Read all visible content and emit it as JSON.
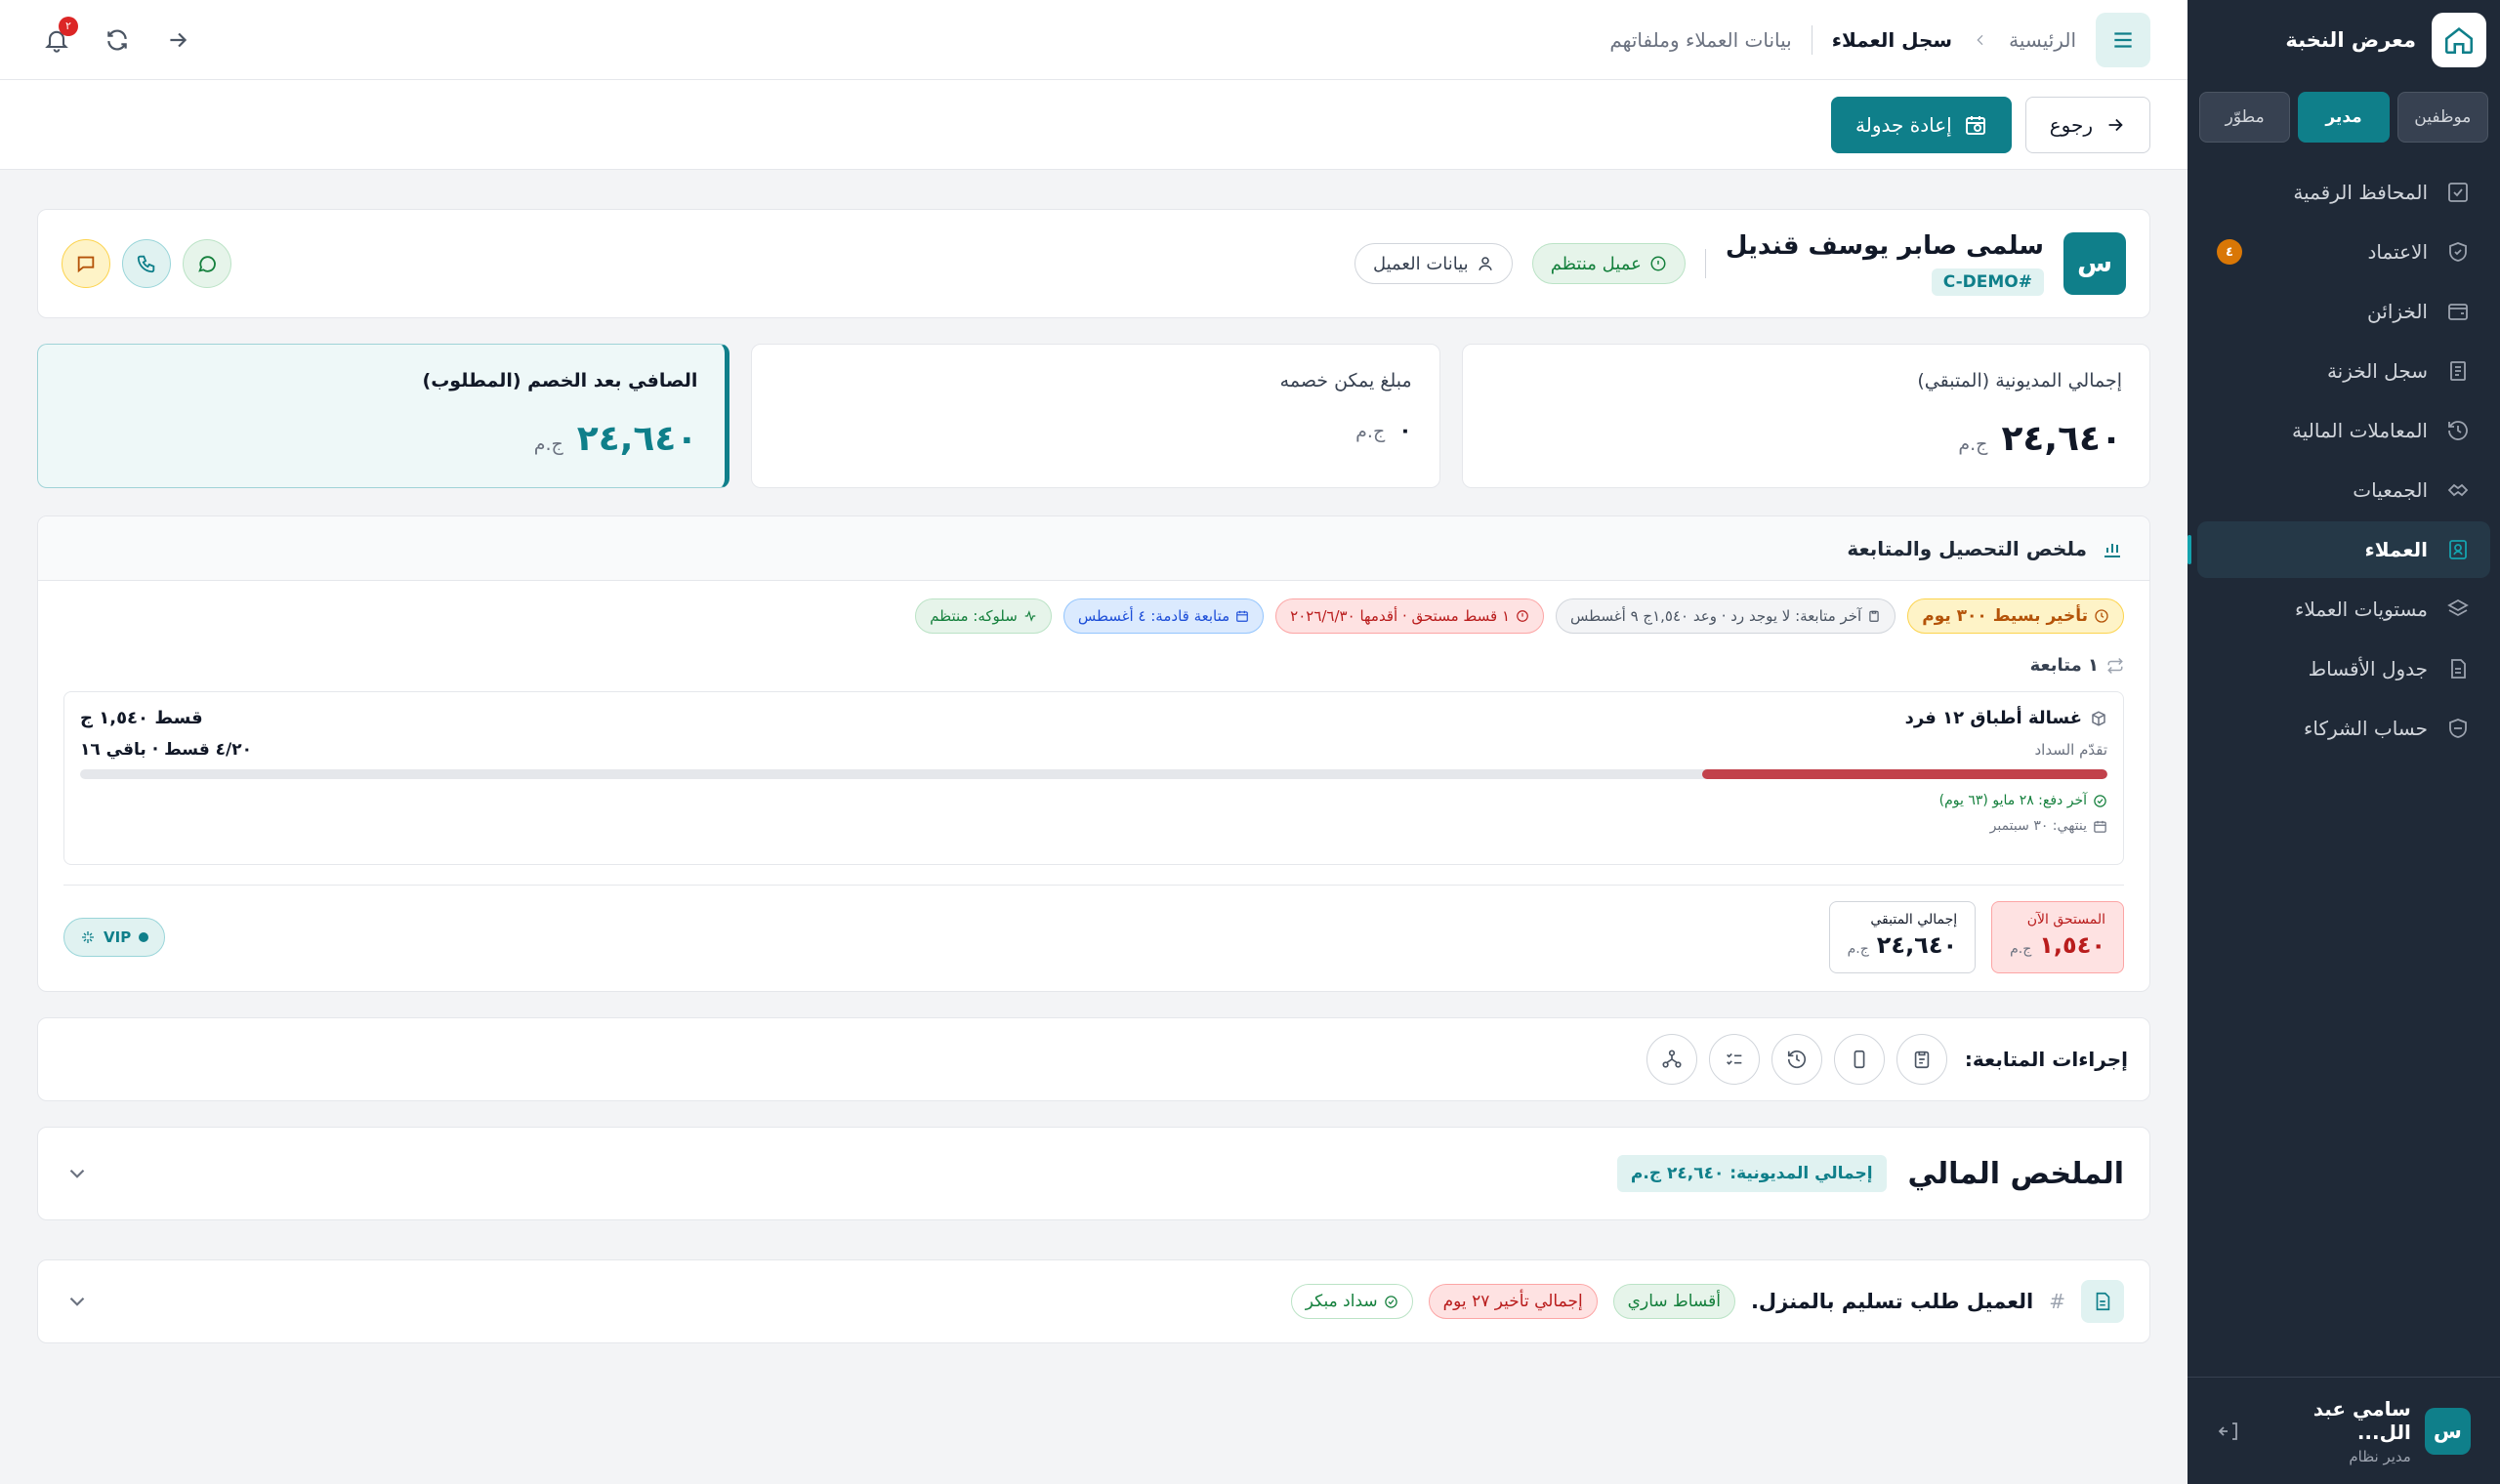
{
  "app": {
    "brand_name": "معرض النخبة"
  },
  "roles": [
    "موظفين",
    "مدير",
    "مطوّر"
  ],
  "active_role_index": 1,
  "sidebar": {
    "items": [
      {
        "label": "المحافظ الرقمية",
        "icon": "wallet-check-icon"
      },
      {
        "label": "الاعتماد",
        "icon": "shield-check-icon",
        "badge": "٤"
      },
      {
        "label": "الخزائن",
        "icon": "safe-icon"
      },
      {
        "label": "سجل الخزنة",
        "icon": "ledger-icon"
      },
      {
        "label": "المعاملات المالية",
        "icon": "history-icon"
      },
      {
        "label": "الجمعيات",
        "icon": "handshake-icon"
      },
      {
        "label": "العملاء",
        "icon": "contact-card-icon",
        "active": true
      },
      {
        "label": "مستويات العملاء",
        "icon": "layers-icon"
      },
      {
        "label": "جدول الأقساط",
        "icon": "document-icon"
      },
      {
        "label": "حساب الشركاء",
        "icon": "partner-icon"
      }
    ]
  },
  "user": {
    "avatar": "س",
    "name": "سامي عبد الل...",
    "role": "مدير نظام"
  },
  "breadcrumb": {
    "home": "الرئيسية",
    "current": "سجل العملاء",
    "subtitle": "بيانات العملاء وملفاتهم"
  },
  "notifications": {
    "count": "٢"
  },
  "actionbar": {
    "back_label": "رجوع",
    "reschedule_label": "إعادة جدولة"
  },
  "customer": {
    "avatar": "س",
    "name": "سلمى صابر يوسف قنديل",
    "code": "C-DEMO#",
    "status": "عميل منتظم",
    "details_label": "بيانات العميل"
  },
  "stats": {
    "total_debt": {
      "title": "إجمالي المديونية (المتبقي)",
      "value": "٢٤,٦٤٠",
      "unit": "ج.م"
    },
    "discountable": {
      "title": "مبلغ يمكن خصمه",
      "value": "٠",
      "unit": "ج.م"
    },
    "net_after": {
      "title": "الصافي بعد الخصم (المطلوب)",
      "value": "٢٤,٦٤٠",
      "unit": "ج.م"
    }
  },
  "collection": {
    "title": "ملخص التحصيل والمتابعة",
    "chips": {
      "delay": "تأخير بسيط ٣٠٠ يوم",
      "last_follow": "آخر متابعة: لا يوجد رد · وعد ١,٥٤٠ج ٩ أغسطس",
      "due": "١ قسط مستحق · أقدمها ٢٠٢٦/٦/٣٠",
      "upcoming": "متابعة قادمة: ٤ أغسطس",
      "behavior": "سلوكه: منتظم"
    },
    "follow_count": "١ متابعة",
    "product": {
      "name": "غسالة أطباق ١٢ فرد",
      "installment": "قسط ١,٥٤٠ ج",
      "progress_label": "تقدّم السداد",
      "installments_text": "٤/٢٠ قسط · باقي ١٦",
      "progress_fraction": 0.2,
      "last_payment": "آخر دفع: ٢٨ مايو (٦٣ يوم)",
      "ends": "ينتهي: ٣٠ سبتمبر"
    },
    "due_now": {
      "label": "المستحق الآن",
      "value": "١,٥٤٠",
      "unit": "ج.م"
    },
    "total_remaining": {
      "label": "إجمالي المتبقي",
      "value": "٢٤,٦٤٠",
      "unit": "ج.م"
    },
    "vip": "VIP"
  },
  "follow_actions": {
    "label": "إجراءات المتابعة:"
  },
  "financial": {
    "title": "الملخص المالي",
    "badge": "إجمالي المديونية: ٢٤,٦٤٠ ج.م"
  },
  "note": {
    "hash": "#",
    "text": "العميل طلب تسليم بالمنزل.",
    "tags": {
      "active": "أقساط ساري",
      "delay": "إجمالي تأخير ٢٧ يوم",
      "early": "سداد مبكر"
    }
  },
  "colors": {
    "primary": "#0f7f8a",
    "sidebar": "#1f2937",
    "danger": "#c2414b"
  }
}
